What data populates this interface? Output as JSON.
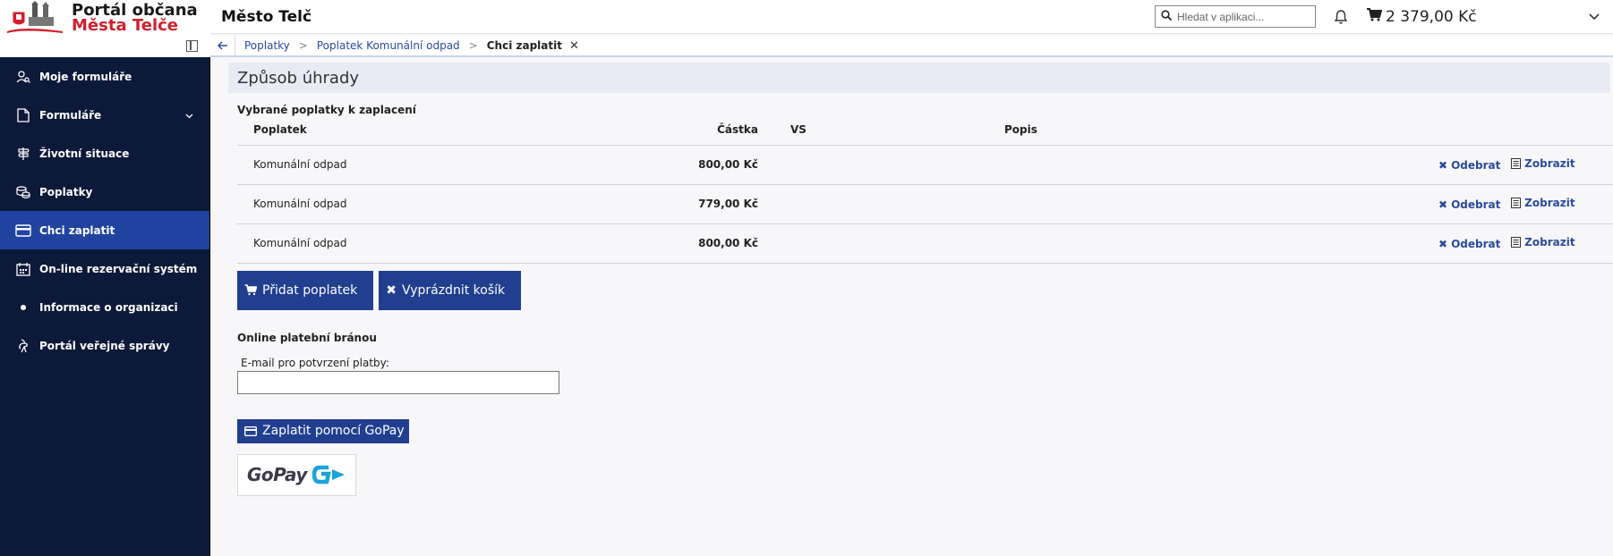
{
  "app": {
    "logo_line1": "Portál občana",
    "logo_line2": "Města Telče",
    "title": "Město Telč"
  },
  "header": {
    "search_placeholder": "Hledat v aplikaci...",
    "cart_amount": "2 379,00 Kč"
  },
  "breadcrumb": {
    "items": [
      "Poplatky",
      "Poplatek Komunální odpad"
    ],
    "separator": ">",
    "current": "Chci zaplatit"
  },
  "sidebar": {
    "items": [
      {
        "label": "Moje formuláře",
        "icon": "user-search-icon"
      },
      {
        "label": "Formuláře",
        "icon": "document-icon"
      },
      {
        "label": "Životní situace",
        "icon": "signpost-icon"
      },
      {
        "label": "Poplatky",
        "icon": "coins-icon"
      },
      {
        "label": "Chci zaplatit",
        "icon": "credit-card-icon",
        "active": true
      },
      {
        "label": "On-line rezervační systém",
        "icon": "calendar-icon"
      },
      {
        "label": "Informace o organizaci",
        "icon": "dot-icon"
      },
      {
        "label": "Portál veřejné správy",
        "icon": "lion-icon"
      }
    ]
  },
  "main": {
    "title": "Způsob úhrady",
    "subtitle": "Vybrané poplatky k zaplacení",
    "table": {
      "headers": [
        "Poplatek",
        "Částka",
        "VS",
        "Popis"
      ],
      "rows": [
        {
          "name": "Komunální odpad",
          "amount": "800,00 Kč",
          "vs": "",
          "desc": ""
        },
        {
          "name": "Komunální odpad",
          "amount": "779,00 Kč",
          "vs": "",
          "desc": ""
        },
        {
          "name": "Komunální odpad",
          "amount": "800,00 Kč",
          "vs": "",
          "desc": ""
        }
      ],
      "action_remove": "Odebrat",
      "action_show": "Zobrazit"
    },
    "add_button": "Přidat poplatek",
    "empty_button": "Vyprázdnit košík",
    "online_title": "Online platební bránou",
    "email_label": "E-mail pro potvrzení platby:",
    "email_value": "",
    "pay_button": "Zaplatit pomocí GoPay",
    "gopay_logo": "GoPay"
  },
  "colors": {
    "sidebar_bg": "#0c1938",
    "sidebar_active": "#2143a0",
    "primary_button": "#213e8f",
    "link": "#2a4a9c",
    "brand_red": "#d21f2b"
  }
}
